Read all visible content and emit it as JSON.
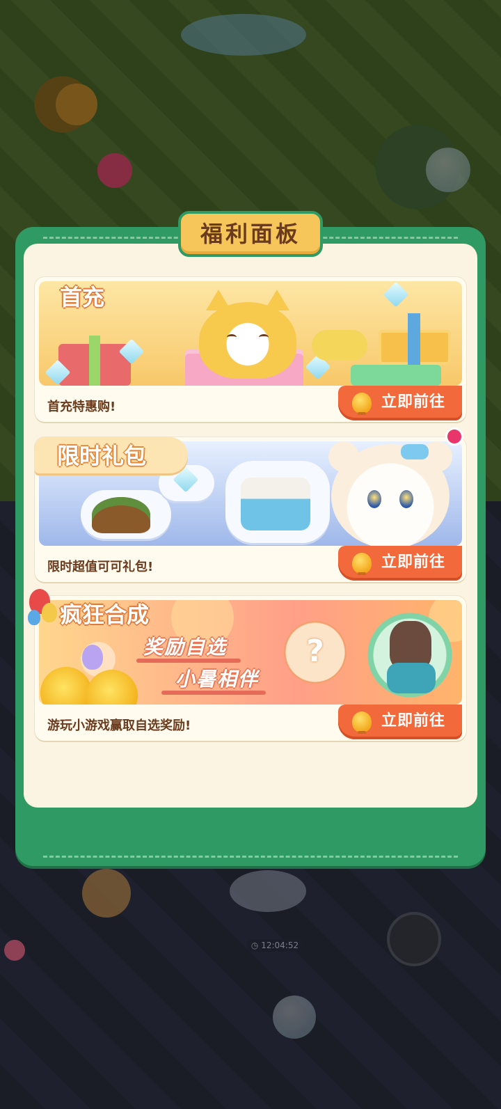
{
  "panel": {
    "title": "福利面板"
  },
  "cards": [
    {
      "title": "首充",
      "description": "首充特惠购!",
      "button_label": "立即前往"
    },
    {
      "title": "限时礼包",
      "description": "限时超值可可礼包!",
      "button_label": "立即前往",
      "has_notification": true
    },
    {
      "title": "疯狂合成",
      "slogan_line1": "奖励自选",
      "slogan_line2": "小暑相伴",
      "mystery_symbol": "?",
      "description": "游玩小游戏赢取自选奖励!",
      "button_label": "立即前往"
    }
  ],
  "background": {
    "timer": "12:04:52"
  },
  "colors": {
    "panel_green": "#2f9a63",
    "panel_cream": "#fbf4e2",
    "title_yellow": "#f6c65a",
    "button_orange": "#f2693c",
    "text_brown": "#6b3b1d",
    "notification_pink": "#e8356a"
  },
  "icons": {
    "button_icon": "chick-icon",
    "timer_icon": "clock-icon"
  }
}
